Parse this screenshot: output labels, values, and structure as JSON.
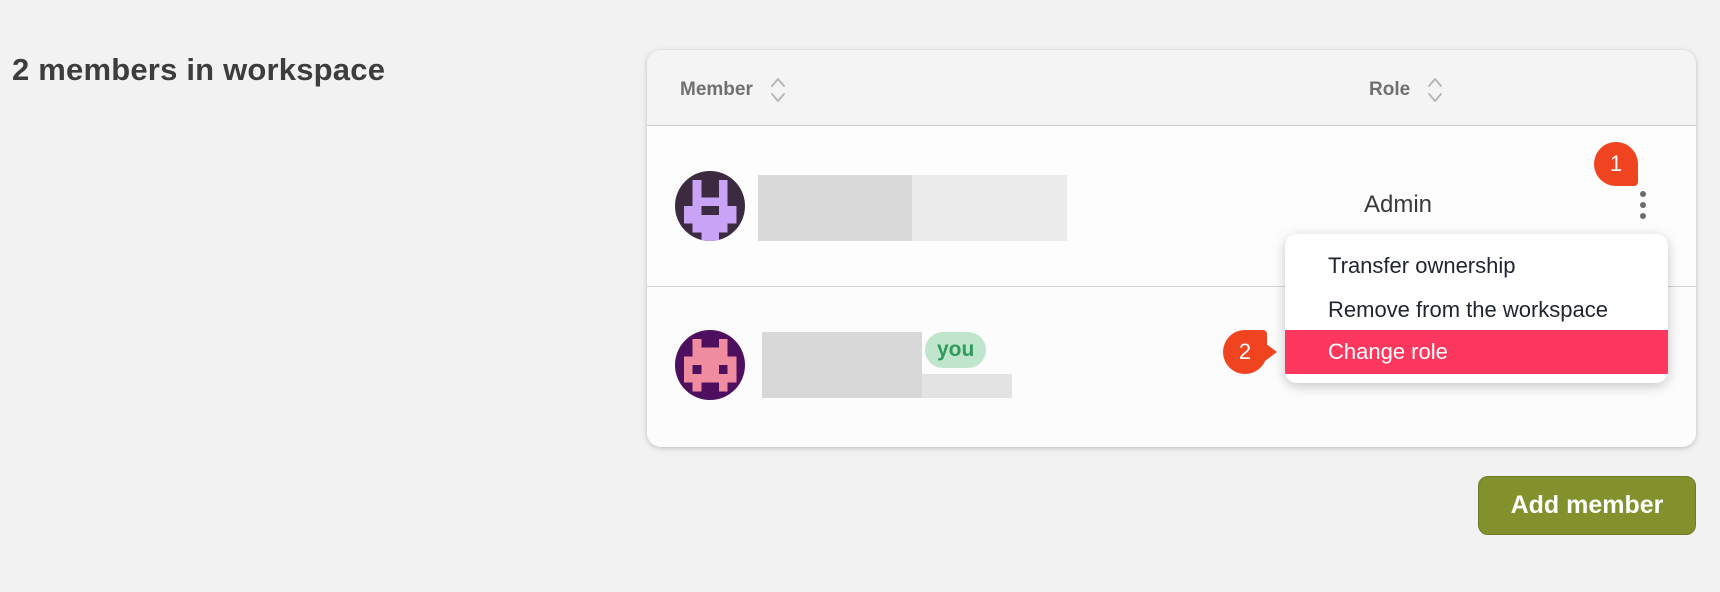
{
  "page": {
    "title": "2 members in workspace"
  },
  "table": {
    "columns": [
      {
        "label": "Member",
        "sortable": true
      },
      {
        "label": "Role",
        "sortable": true
      }
    ],
    "rows": [
      {
        "member_name": "",
        "role": "Admin",
        "is_current_user": false,
        "avatar_colors": {
          "bg": "#3b2a40",
          "fg": "#c9a3f5"
        }
      },
      {
        "member_name": "",
        "role": "",
        "is_current_user": true,
        "you_label": "you",
        "avatar_colors": {
          "bg": "#4d0f5e",
          "fg": "#f08ca0"
        }
      }
    ]
  },
  "context_menu": {
    "items": [
      {
        "label": "Transfer ownership",
        "highlighted": false
      },
      {
        "label": "Remove from the workspace",
        "highlighted": false
      },
      {
        "label": "Change role",
        "highlighted": true
      }
    ]
  },
  "annotations": {
    "marker_1": "1",
    "marker_2": "2"
  },
  "actions": {
    "add_member_label": "Add member"
  },
  "colors": {
    "background": "#f2f2f2",
    "accent_button": "#83912d",
    "menu_highlight": "#fe375f",
    "marker": "#f0431f",
    "you_badge_bg": "#bfe5cd",
    "you_badge_text": "#2f9a5a"
  },
  "icons": {
    "sort": "sort-icon",
    "more": "kebab-menu-icon"
  }
}
